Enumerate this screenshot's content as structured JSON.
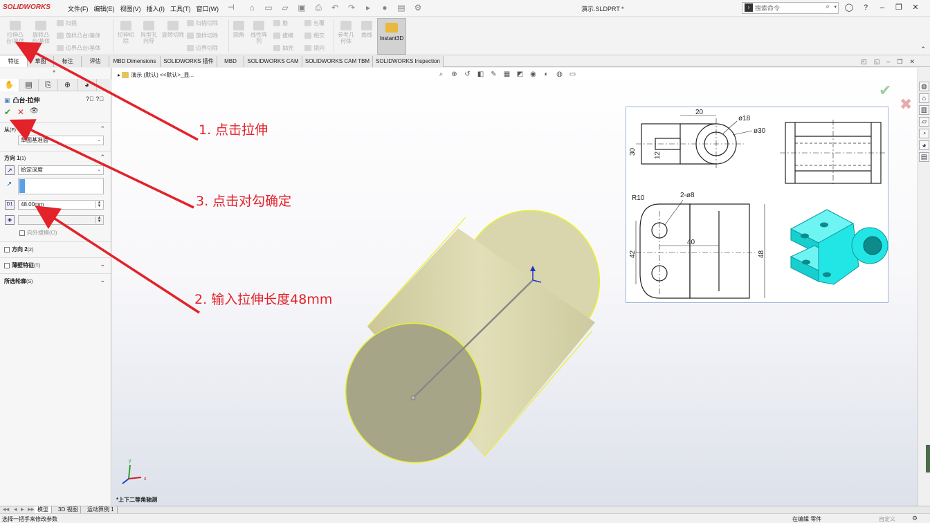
{
  "app": {
    "logo": "SOLIDWORKS",
    "menus": [
      "文件(F)",
      "编辑(E)",
      "视图(V)",
      "插入(I)",
      "工具(T)",
      "窗口(W)"
    ],
    "doc_title": "演示.SLDPRT *",
    "search_placeholder": "搜索命令"
  },
  "ribbon": {
    "extrude_boss": "拉伸凸台/基体",
    "revolve_boss": "旋转凸台/基体",
    "sweep": "扫描",
    "loft": "放样凸台/基体",
    "boundary_boss": "边界凸台/基体",
    "extrude_cut": "拉伸切除",
    "hole_wizard": "异型孔向导",
    "revolve_cut": "旋转切除",
    "swept_cut": "扫描切除",
    "lofted_cut": "放样切除",
    "boundary_cut": "边界切除",
    "fillet": "圆角",
    "linear_pattern": "线性阵列",
    "rib": "筋",
    "draft": "拔模",
    "shell": "抽壳",
    "wrap": "包覆",
    "intersect": "相交",
    "mirror": "镜向",
    "ref_geometry": "参考几何体",
    "curves": "曲线",
    "instant3d": "Instant3D"
  },
  "tabs": [
    "特征",
    "草图",
    "标注",
    "评估",
    "MBD Dimensions",
    "SOLIDWORKS 插件",
    "MBD",
    "SOLIDWORKS CAM",
    "SOLIDWORKS CAM TBM",
    "SOLIDWORKS Inspection"
  ],
  "property_manager": {
    "title": "凸台-拉伸",
    "from_label": "从",
    "from_key": "(F)",
    "from_value": "草图基准面",
    "dir1_label": "方向 1",
    "dir1_key": "(1)",
    "end_condition": "给定深度",
    "depth": "48.00mm",
    "draft_outward": "向外拔模(O)",
    "dir2_label": "方向 2",
    "dir2_key": "(2)",
    "thin_feature": "薄壁特征",
    "thin_key": "(T)",
    "selected_contours": "所选轮廓",
    "contours_key": "(S)"
  },
  "viewport": {
    "breadcrumb": "演示 (默认) <<默认>_显...",
    "view_label": "*上下二等角轴测",
    "triad_x": "x",
    "triad_y": "y"
  },
  "drawing": {
    "dim_20": "20",
    "dim_phi18": "ø18",
    "dim_phi30": "ø30",
    "dim_30": "30",
    "dim_12": "12",
    "dim_r10": "R10",
    "dim_2phi8": "2-ø8",
    "dim_40": "40",
    "dim_42": "42",
    "dim_48": "48"
  },
  "bottom_tabs": [
    "模型",
    "3D 视图",
    "运动算例 1"
  ],
  "status": {
    "left": "选择一把手来修改参数",
    "editing": "在编辑 零件",
    "units": "自定义"
  },
  "annotations": {
    "step1": "1. 点击拉伸",
    "step2": "2. 输入拉伸长度48mm",
    "step3": "3. 点击对勾确定"
  },
  "colors": {
    "annotation_red": "#e3222a",
    "cylinder_fill": "#d4d1a4",
    "cylinder_end": "#a6a587",
    "edge_yellow": "#e8f02a",
    "iso_cyan": "#22e6e6",
    "ok_green": "#2fa02f",
    "cancel_red": "#d33333"
  }
}
